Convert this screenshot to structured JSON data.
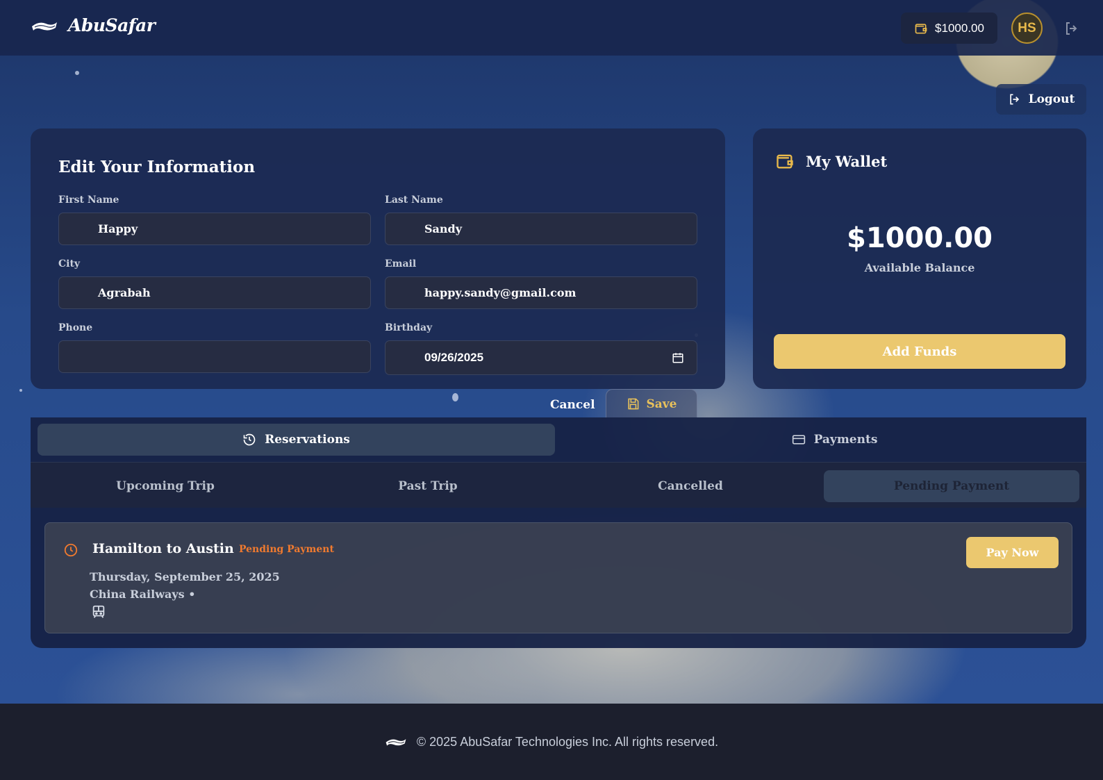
{
  "header": {
    "brand": "AbuSafar",
    "wallet_balance": "$1000.00",
    "avatar_initials": "HS"
  },
  "logout_label": "Logout",
  "edit_form": {
    "title": "Edit Your Information",
    "first_name": {
      "label": "First Name",
      "value": "Happy"
    },
    "last_name": {
      "label": "Last Name",
      "value": "Sandy"
    },
    "city": {
      "label": "City",
      "value": "Agrabah"
    },
    "email": {
      "label": "Email",
      "value": "happy.sandy@gmail.com"
    },
    "phone": {
      "label": "Phone",
      "value": ""
    },
    "birthday": {
      "label": "Birthday",
      "value": "09/26/2025"
    },
    "cancel_label": "Cancel",
    "save_label": "Save"
  },
  "wallet": {
    "title": "My Wallet",
    "amount": "$1000.00",
    "subtitle": "Available Balance",
    "add_funds_label": "Add Funds"
  },
  "main_tabs": [
    {
      "label": "Reservations",
      "icon": "history-icon",
      "active": true
    },
    {
      "label": "Payments",
      "icon": "credit-card-icon",
      "active": false
    }
  ],
  "sub_tabs": [
    {
      "label": "Upcoming Trip",
      "active": false
    },
    {
      "label": "Past Trip",
      "active": false
    },
    {
      "label": "Cancelled",
      "active": false
    },
    {
      "label": "Pending Payment",
      "active": true
    }
  ],
  "reservation": {
    "title": "Hamilton to Austin",
    "status": "Pending Payment",
    "date": "Thursday, September 25, 2025",
    "operator": "China Railways •",
    "pay_label": "Pay Now"
  },
  "footer": {
    "text": "© 2025 AbuSafar Technologies Inc. All rights reserved."
  },
  "colors": {
    "accent_gold": "#ebc86f",
    "status_orange": "#f07a2f",
    "card_bg": "#1c2a52"
  }
}
